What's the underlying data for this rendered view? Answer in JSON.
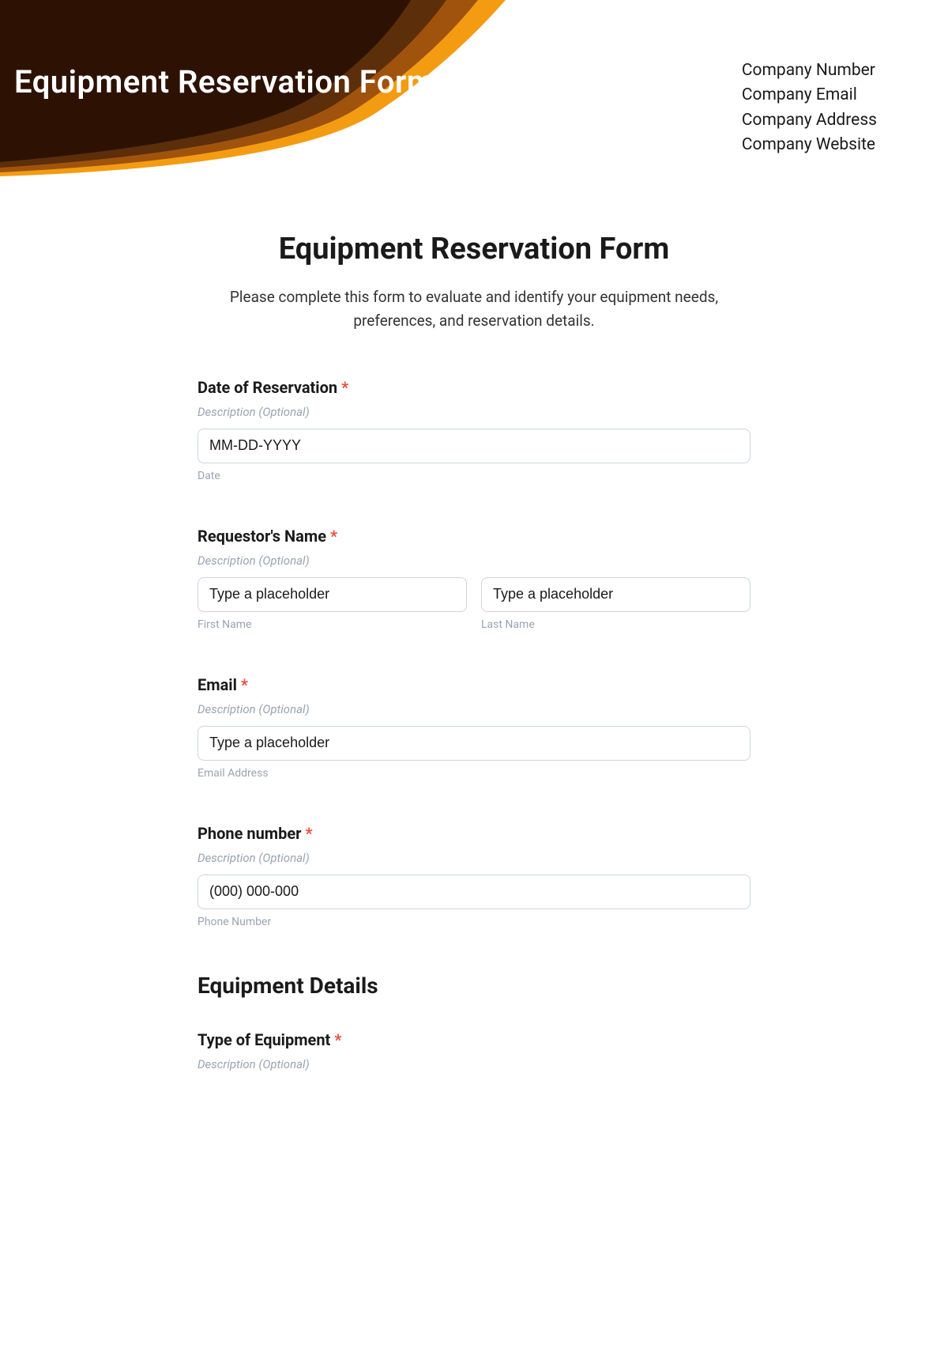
{
  "header": {
    "title": "Equipment Reservation Form",
    "company": {
      "number": "Company Number",
      "email": "Company Email",
      "address": "Company Address",
      "website": "Company Website"
    }
  },
  "form": {
    "title": "Equipment Reservation Form",
    "intro": "Please complete this form to evaluate and identify your equipment needs, preferences, and reservation details.",
    "desc_placeholder": "Description (Optional)",
    "required_mark": "*",
    "fields": {
      "date": {
        "label": "Date of Reservation",
        "placeholder": "MM-DD-YYYY",
        "sublabel": "Date"
      },
      "name": {
        "label": "Requestor's Name",
        "first_placeholder": "Type a placeholder",
        "last_placeholder": "Type a placeholder",
        "first_sublabel": "First Name",
        "last_sublabel": "Last Name"
      },
      "email": {
        "label": "Email",
        "placeholder": "Type a placeholder",
        "sublabel": "Email Address"
      },
      "phone": {
        "label": "Phone number",
        "placeholder": "(000) 000-000",
        "sublabel": "Phone Number"
      },
      "equipment_section": "Equipment Details",
      "equipment_type": {
        "label": "Type of Equipment"
      }
    }
  }
}
